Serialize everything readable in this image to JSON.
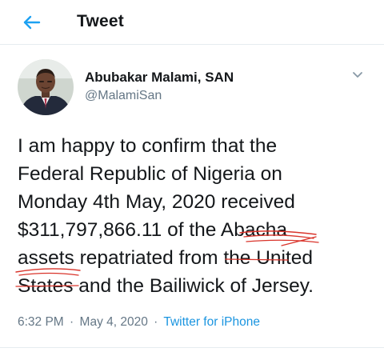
{
  "header": {
    "title": "Tweet",
    "back_icon": "arrow-left-icon"
  },
  "author": {
    "name": "Abubakar Malami, SAN",
    "handle": "@MalamiSan",
    "avatar_icon": "avatar-photo"
  },
  "menu_icon": "chevron-down-icon",
  "tweet": {
    "text": "I am happy to confirm that the\nFederal Republic of Nigeria on\nMonday 4th May, 2020 received\n$311,797,866.11 of the Abacha\nassets repatriated from the United\nStates and the Bailiwick of Jersey."
  },
  "meta": {
    "time": "6:32 PM",
    "separator": "·",
    "date": "May 4, 2020",
    "source": "Twitter for iPhone"
  },
  "colors": {
    "accent": "#1da1f2",
    "link": "#1b95e0",
    "secondary_text": "#657786",
    "handwritten_markup": "#d9342b"
  }
}
